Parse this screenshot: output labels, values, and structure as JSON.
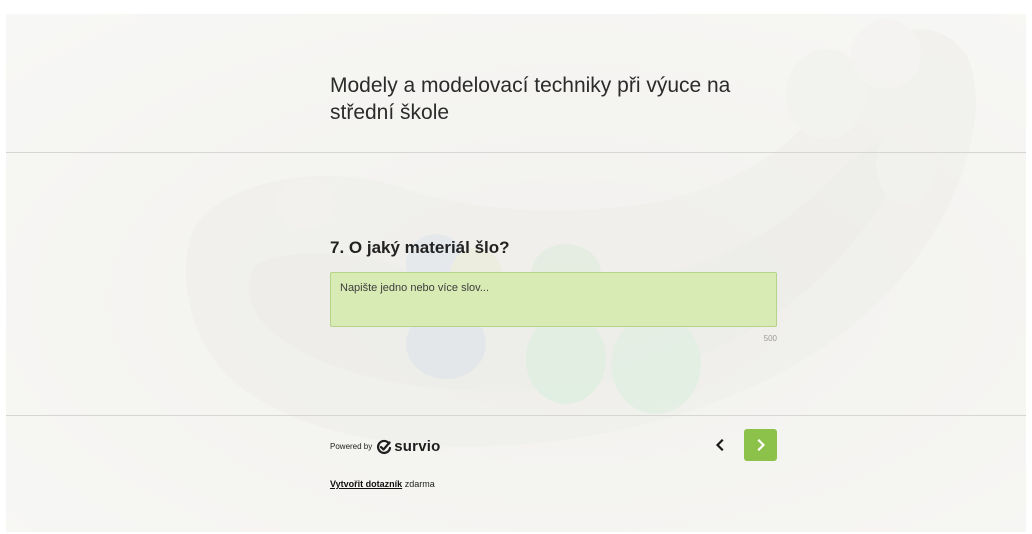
{
  "survey": {
    "title": "Modely a modelovací techniky při výuce na střední škole"
  },
  "question": {
    "label": "7. O jaký materiál šlo?",
    "input_placeholder": "Napište jedno nebo více slov...",
    "input_value": "",
    "char_limit": "500"
  },
  "footer": {
    "powered_by": "Powered by",
    "brand": "survio",
    "create_link": "Vytvořit dotazník",
    "create_suffix": " zdarma"
  },
  "navigation": {
    "prev_icon": "chevron-left-icon",
    "next_icon": "chevron-right-icon"
  },
  "colors": {
    "accent": "#8cc14a",
    "input_bg": "#d9ebb4"
  }
}
